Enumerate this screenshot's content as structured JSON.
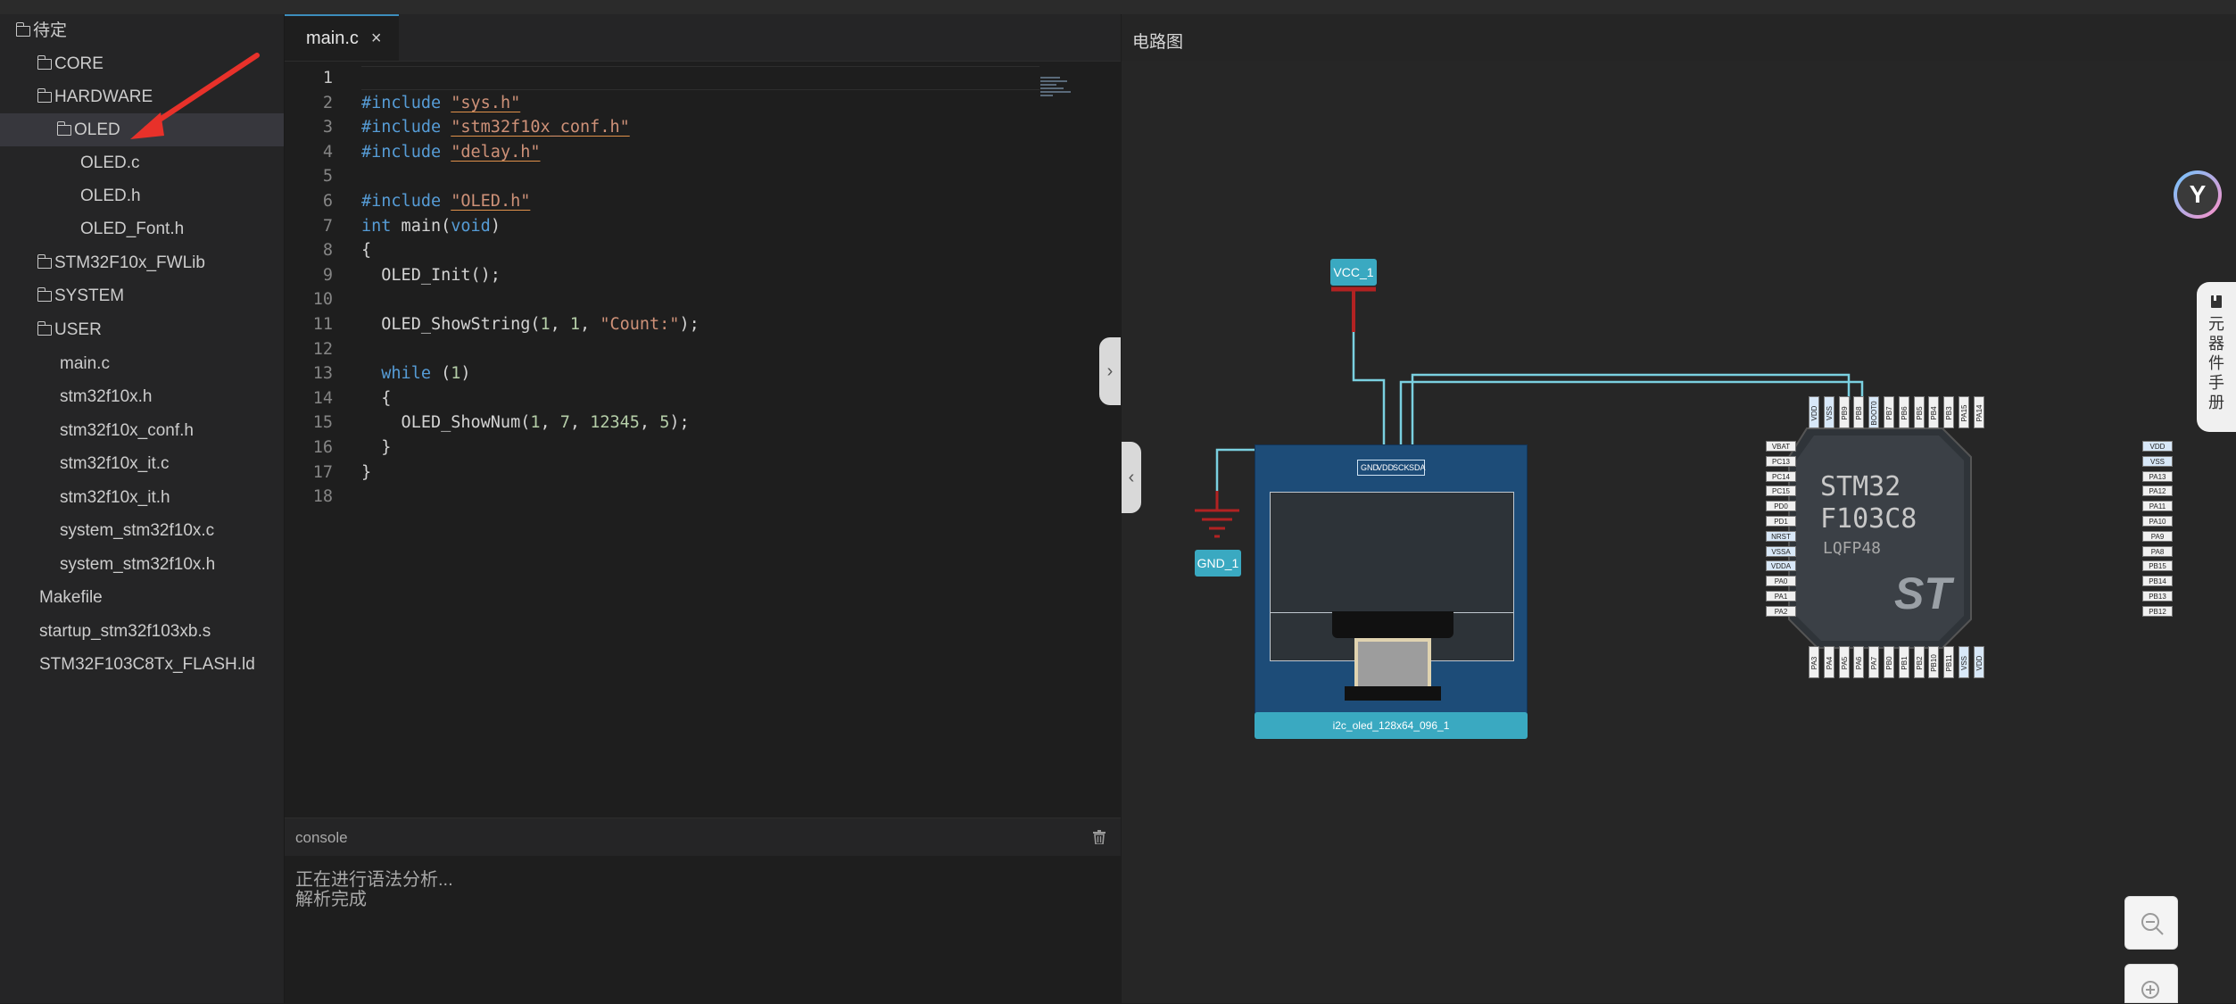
{
  "sidebar": {
    "items": [
      {
        "label": "待定",
        "type": "folder"
      },
      {
        "label": "CORE",
        "type": "folder"
      },
      {
        "label": "HARDWARE",
        "type": "folder"
      },
      {
        "label": "OLED",
        "type": "folder",
        "selected": true
      },
      {
        "label": "OLED.c",
        "type": "file"
      },
      {
        "label": "OLED.h",
        "type": "file"
      },
      {
        "label": "OLED_Font.h",
        "type": "file"
      },
      {
        "label": "STM32F10x_FWLib",
        "type": "folder"
      },
      {
        "label": "SYSTEM",
        "type": "folder"
      },
      {
        "label": "USER",
        "type": "folder"
      },
      {
        "label": "main.c",
        "type": "file"
      },
      {
        "label": "stm32f10x.h",
        "type": "file"
      },
      {
        "label": "stm32f10x_conf.h",
        "type": "file"
      },
      {
        "label": "stm32f10x_it.c",
        "type": "file"
      },
      {
        "label": "stm32f10x_it.h",
        "type": "file"
      },
      {
        "label": "system_stm32f10x.c",
        "type": "file"
      },
      {
        "label": "system_stm32f10x.h",
        "type": "file"
      },
      {
        "label": "Makefile",
        "type": "file"
      },
      {
        "label": "startup_stm32f103xb.s",
        "type": "file"
      },
      {
        "label": "STM32F103C8Tx_FLASH.ld",
        "type": "file"
      }
    ]
  },
  "editor": {
    "tab": {
      "label": "main.c",
      "close": "×"
    },
    "lines": [
      {
        "n": "1",
        "text": ""
      },
      {
        "n": "2",
        "text": "#include \"sys.h\""
      },
      {
        "n": "3",
        "text": "#include \"stm32f10x_conf.h\""
      },
      {
        "n": "4",
        "text": "#include \"delay.h\""
      },
      {
        "n": "5",
        "text": ""
      },
      {
        "n": "6",
        "text": "#include \"OLED.h\""
      },
      {
        "n": "7",
        "text": "int main(void)"
      },
      {
        "n": "8",
        "text": "{"
      },
      {
        "n": "9",
        "text": "  OLED_Init();"
      },
      {
        "n": "10",
        "text": ""
      },
      {
        "n": "11",
        "text": "  OLED_ShowString(1, 1, \"Count:\");"
      },
      {
        "n": "12",
        "text": ""
      },
      {
        "n": "13",
        "text": "  while (1)"
      },
      {
        "n": "14",
        "text": "  {"
      },
      {
        "n": "15",
        "text": "    OLED_ShowNum(1, 7, 12345, 5);"
      },
      {
        "n": "16",
        "text": "  }"
      },
      {
        "n": "17",
        "text": "}"
      },
      {
        "n": "18",
        "text": ""
      }
    ]
  },
  "console": {
    "title": "console",
    "lines": [
      "正在进行语法分析...",
      "解析完成"
    ]
  },
  "circuit": {
    "title": "电路图",
    "vcc_label": "VCC_1",
    "gnd_label": "GND_1",
    "oled": {
      "label": "i2c_oled_128x64_096_1",
      "pins": [
        "GND",
        "VDD",
        "SCK",
        "SDA"
      ]
    },
    "mcu": {
      "name1": "STM32",
      "name2": "F103C8",
      "package": "LQFP48",
      "logo": "ST",
      "left_pins": [
        "VBAT",
        "PC13",
        "PC14",
        "PC15",
        "PD0",
        "PD1",
        "NRST",
        "VSSA",
        "VDDA",
        "PA0",
        "PA1",
        "PA2"
      ],
      "right_pins": [
        "VDD",
        "VSS",
        "PA13",
        "PA12",
        "PA11",
        "PA10",
        "PA9",
        "PA8",
        "PB15",
        "PB14",
        "PB13",
        "PB12"
      ],
      "top_pins": [
        "VDD",
        "VSS",
        "PB9",
        "PB8",
        "BOOT0",
        "PB7",
        "PB6",
        "PB5",
        "PB4",
        "PB3",
        "PA15",
        "PA14"
      ],
      "bottom_pins": [
        "PA3",
        "PA4",
        "PA5",
        "PA6",
        "PA7",
        "PB0",
        "PB1",
        "PB2",
        "PB10",
        "PB11",
        "VSS",
        "VDD"
      ]
    },
    "manual_tab": "元器件手册",
    "avatar_glyph": "Y"
  }
}
